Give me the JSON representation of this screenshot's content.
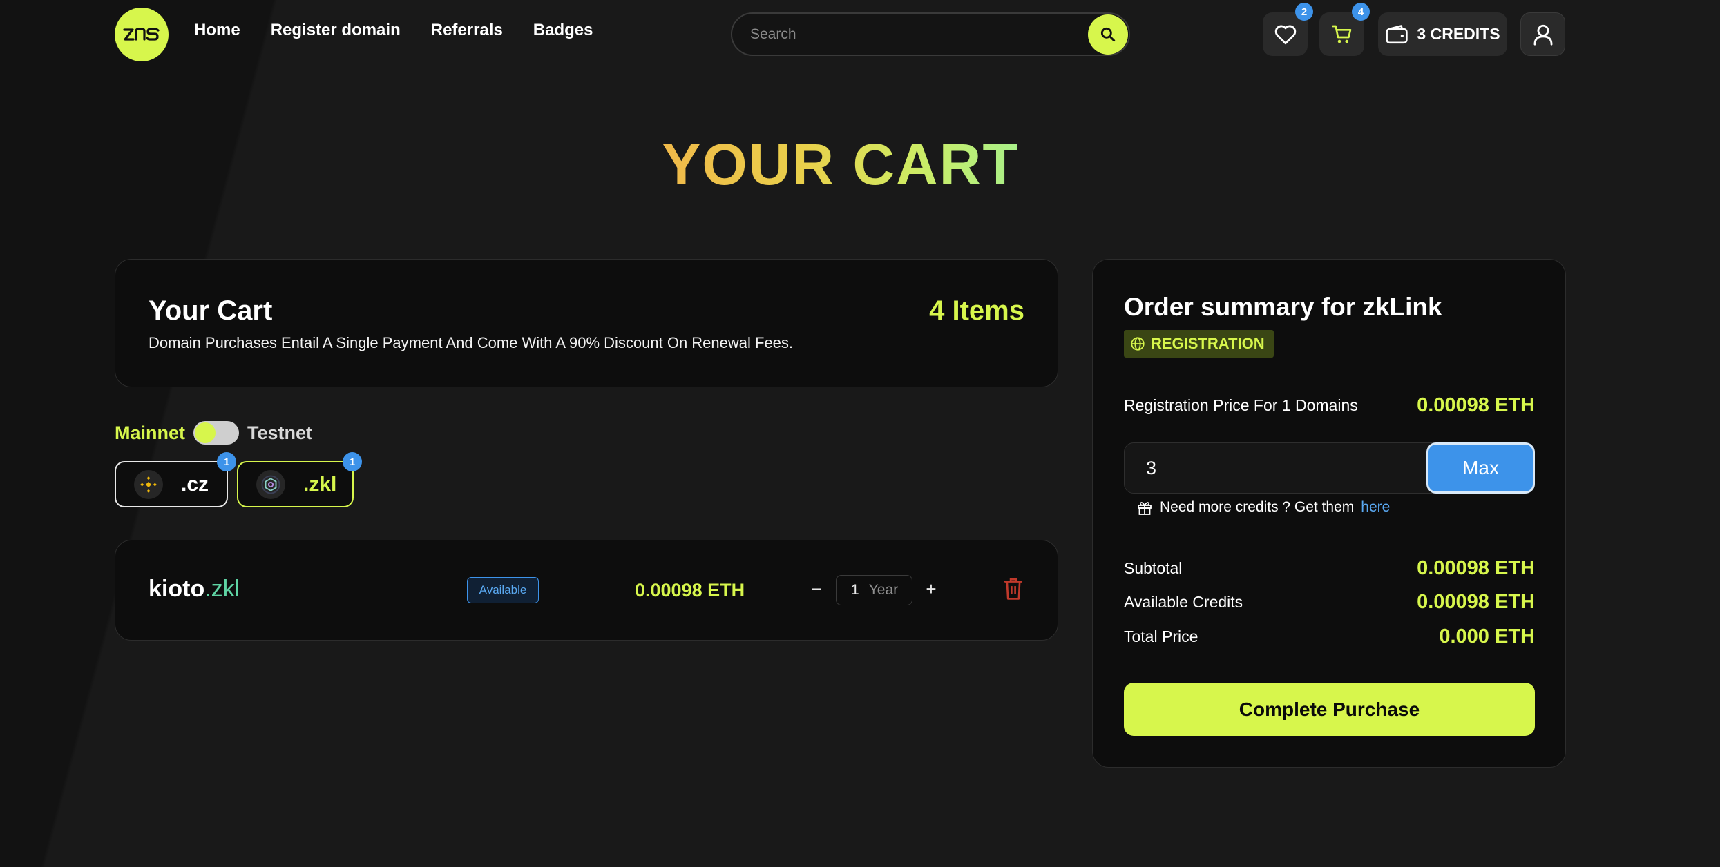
{
  "header": {
    "logo_text": "zns",
    "nav": [
      {
        "label": "Home"
      },
      {
        "label": "Register domain"
      },
      {
        "label": "Referrals"
      },
      {
        "label": "Badges"
      }
    ],
    "search": {
      "placeholder": "Search"
    },
    "favorites_count": "2",
    "cart_count": "4",
    "credits_label": "3 CREDITS"
  },
  "page_title": "YOUR CART",
  "cart": {
    "title": "Your Cart",
    "subtitle": "Domain Purchases Entail A Single Payment And Come With A 90% Discount On Renewal Fees.",
    "item_count": "4 Items",
    "network": {
      "left": "Mainnet",
      "right": "Testnet",
      "active": "Mainnet"
    },
    "tlds": [
      {
        "label": ".cz",
        "count": "1",
        "icon": "bnb-icon"
      },
      {
        "label": ".zkl",
        "count": "1",
        "icon": "zklink-icon",
        "selected": true
      }
    ],
    "items": [
      {
        "name": "kioto",
        "tld": ".zkl",
        "status": "Available",
        "price": "0.00098 ETH",
        "quantity": "1",
        "unit": "Year"
      }
    ]
  },
  "summary": {
    "title": "Order summary for zkLink",
    "tag": "REGISTRATION",
    "registration_label": "Registration Price For 1 Domains",
    "registration_value": "0.00098 ETH",
    "credits_input_value": "3",
    "max_label": "Max",
    "need_credits_text": "Need more credits ? Get them",
    "need_credits_link": "here",
    "subtotal_label": "Subtotal",
    "subtotal_value": "0.00098 ETH",
    "available_label": "Available Credits",
    "available_value": "0.00098 ETH",
    "total_label": "Total Price",
    "total_value": "0.000 ETH",
    "purchase_label": "Complete Purchase"
  },
  "colors": {
    "accent": "#d7f64c",
    "blue": "#3d93ea",
    "background": "#171717",
    "card": "#0d0d0d",
    "danger": "#c0392b"
  }
}
